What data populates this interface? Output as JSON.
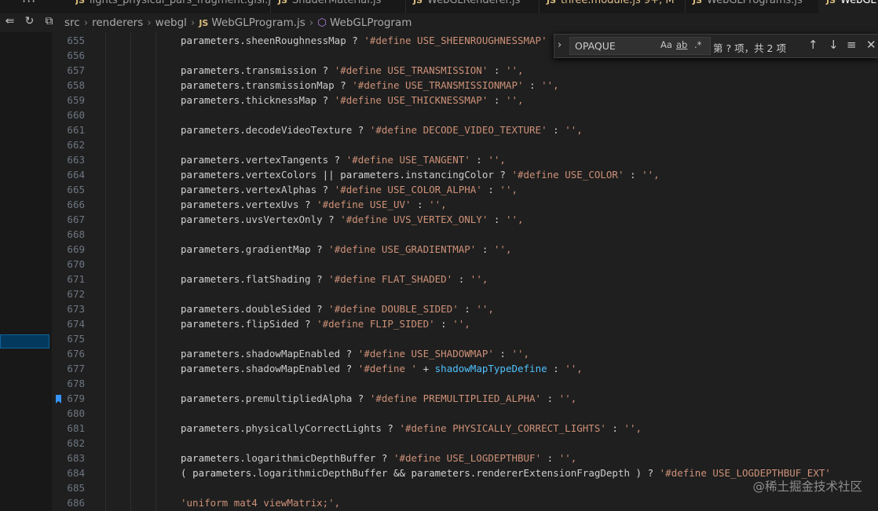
{
  "tabs": [
    {
      "label": "lights_physical_pars_fragment.glsl.js",
      "active": false
    },
    {
      "label": "ShaderMaterial.js",
      "active": false
    },
    {
      "label": "WebGLRenderer.js",
      "active": false
    },
    {
      "label": "three.module.js",
      "badge": "9+, M",
      "active": false,
      "modified": true
    },
    {
      "label": "WebGLPrograms.js",
      "active": false
    },
    {
      "label": "WebGL",
      "active": true
    }
  ],
  "breadcrumb": {
    "items": [
      "src",
      "renderers",
      "webgl",
      "WebGLProgram.js",
      "WebGLProgram"
    ]
  },
  "find": {
    "query": "OPAQUE",
    "options": [
      "Aa",
      "ab",
      ".*"
    ],
    "result": "第 ? 项，共 2 项"
  },
  "icons": {
    "toolbar": [
      "split-editor-icon",
      "undo-icon",
      "copy-icon"
    ],
    "find_toggle": "chevron-right-icon",
    "find_buttons": [
      "arrow-up-icon",
      "arrow-down-icon",
      "selection-icon",
      "close-icon"
    ]
  },
  "colors": {
    "string": "#ce9178",
    "identifier": "#cccccc",
    "highlight_identifier": "#4fc1ff",
    "line_number": "#6e7681",
    "bookmark": "#3794ff"
  },
  "code_lines": [
    {
      "num": "655",
      "segments": [
        [
          "p",
          "parameters."
        ],
        [
          "i",
          "sheenRoughnessMap"
        ],
        [
          "o",
          " ? "
        ],
        [
          "s",
          "'#define USE_SHEENROUGHNESSMAP' : '',"
        ]
      ]
    },
    {
      "num": "656",
      "segments": []
    },
    {
      "num": "657",
      "segments": [
        [
          "p",
          "parameters."
        ],
        [
          "i",
          "transmission"
        ],
        [
          "o",
          " ? "
        ],
        [
          "s",
          "'#define USE_TRANSMISSION'"
        ],
        [
          "o",
          " : "
        ],
        [
          "s",
          "'',"
        ]
      ]
    },
    {
      "num": "658",
      "segments": [
        [
          "p",
          "parameters."
        ],
        [
          "i",
          "transmissionMap"
        ],
        [
          "o",
          " ? "
        ],
        [
          "s",
          "'#define USE_TRANSMISSIONMAP'"
        ],
        [
          "o",
          " : "
        ],
        [
          "s",
          "'',"
        ]
      ]
    },
    {
      "num": "659",
      "segments": [
        [
          "p",
          "parameters."
        ],
        [
          "i",
          "thicknessMap"
        ],
        [
          "o",
          " ? "
        ],
        [
          "s",
          "'#define USE_THICKNESSMAP'"
        ],
        [
          "o",
          " : "
        ],
        [
          "s",
          "'',"
        ]
      ]
    },
    {
      "num": "660",
      "segments": []
    },
    {
      "num": "661",
      "segments": [
        [
          "p",
          "parameters."
        ],
        [
          "i",
          "decodeVideoTexture"
        ],
        [
          "o",
          " ? "
        ],
        [
          "s",
          "'#define DECODE_VIDEO_TEXTURE'"
        ],
        [
          "o",
          " : "
        ],
        [
          "s",
          "'',"
        ]
      ]
    },
    {
      "num": "662",
      "segments": []
    },
    {
      "num": "663",
      "segments": [
        [
          "p",
          "parameters."
        ],
        [
          "i",
          "vertexTangents"
        ],
        [
          "o",
          " ? "
        ],
        [
          "s",
          "'#define USE_TANGENT'"
        ],
        [
          "o",
          " : "
        ],
        [
          "s",
          "'',"
        ]
      ]
    },
    {
      "num": "664",
      "segments": [
        [
          "p",
          "parameters."
        ],
        [
          "i",
          "vertexColors"
        ],
        [
          "o",
          " || "
        ],
        [
          "p",
          "parameters."
        ],
        [
          "i",
          "instancingColor"
        ],
        [
          "o",
          " ? "
        ],
        [
          "s",
          "'#define USE_COLOR'"
        ],
        [
          "o",
          " : "
        ],
        [
          "s",
          "'',"
        ]
      ]
    },
    {
      "num": "665",
      "segments": [
        [
          "p",
          "parameters."
        ],
        [
          "i",
          "vertexAlphas"
        ],
        [
          "o",
          " ? "
        ],
        [
          "s",
          "'#define USE_COLOR_ALPHA'"
        ],
        [
          "o",
          " : "
        ],
        [
          "s",
          "'',"
        ]
      ]
    },
    {
      "num": "666",
      "segments": [
        [
          "p",
          "parameters."
        ],
        [
          "i",
          "vertexUvs"
        ],
        [
          "o",
          " ? "
        ],
        [
          "s",
          "'#define USE_UV'"
        ],
        [
          "o",
          " : "
        ],
        [
          "s",
          "'',"
        ]
      ]
    },
    {
      "num": "667",
      "segments": [
        [
          "p",
          "parameters."
        ],
        [
          "i",
          "uvsVertexOnly"
        ],
        [
          "o",
          " ? "
        ],
        [
          "s",
          "'#define UVS_VERTEX_ONLY'"
        ],
        [
          "o",
          " : "
        ],
        [
          "s",
          "'',"
        ]
      ]
    },
    {
      "num": "668",
      "segments": []
    },
    {
      "num": "669",
      "segments": [
        [
          "p",
          "parameters."
        ],
        [
          "i",
          "gradientMap"
        ],
        [
          "o",
          " ? "
        ],
        [
          "s",
          "'#define USE_GRADIENTMAP'"
        ],
        [
          "o",
          " : "
        ],
        [
          "s",
          "'',"
        ]
      ]
    },
    {
      "num": "670",
      "segments": []
    },
    {
      "num": "671",
      "segments": [
        [
          "p",
          "parameters."
        ],
        [
          "i",
          "flatShading"
        ],
        [
          "o",
          " ? "
        ],
        [
          "s",
          "'#define FLAT_SHADED'"
        ],
        [
          "o",
          " : "
        ],
        [
          "s",
          "'',"
        ]
      ]
    },
    {
      "num": "672",
      "segments": []
    },
    {
      "num": "673",
      "segments": [
        [
          "p",
          "parameters."
        ],
        [
          "i",
          "doubleSided"
        ],
        [
          "o",
          " ? "
        ],
        [
          "s",
          "'#define DOUBLE_SIDED'"
        ],
        [
          "o",
          " : "
        ],
        [
          "s",
          "'',"
        ]
      ]
    },
    {
      "num": "674",
      "segments": [
        [
          "p",
          "parameters."
        ],
        [
          "i",
          "flipSided"
        ],
        [
          "o",
          " ? "
        ],
        [
          "s",
          "'#define FLIP_SIDED'"
        ],
        [
          "o",
          " : "
        ],
        [
          "s",
          "'',"
        ]
      ]
    },
    {
      "num": "675",
      "segments": []
    },
    {
      "num": "676",
      "segments": [
        [
          "p",
          "parameters."
        ],
        [
          "i",
          "shadowMapEnabled"
        ],
        [
          "o",
          " ? "
        ],
        [
          "s",
          "'#define USE_SHADOWMAP'"
        ],
        [
          "o",
          " : "
        ],
        [
          "s",
          "'',"
        ]
      ]
    },
    {
      "num": "677",
      "segments": [
        [
          "p",
          "parameters."
        ],
        [
          "i",
          "shadowMapEnabled"
        ],
        [
          "o",
          " ? "
        ],
        [
          "s",
          "'#define '"
        ],
        [
          "o",
          " + "
        ],
        [
          "h",
          "shadowMapTypeDefine"
        ],
        [
          "o",
          " : "
        ],
        [
          "s",
          "'',"
        ]
      ]
    },
    {
      "num": "678",
      "segments": []
    },
    {
      "num": "679",
      "segments": [
        [
          "p",
          "parameters."
        ],
        [
          "i",
          "premultipliedAlpha"
        ],
        [
          "o",
          " ? "
        ],
        [
          "s",
          "'#define PREMULTIPLIED_ALPHA'"
        ],
        [
          "o",
          " : "
        ],
        [
          "s",
          "'',"
        ]
      ],
      "bookmark": true
    },
    {
      "num": "680",
      "segments": []
    },
    {
      "num": "681",
      "segments": [
        [
          "p",
          "parameters."
        ],
        [
          "i",
          "physicallyCorrectLights"
        ],
        [
          "o",
          " ? "
        ],
        [
          "s",
          "'#define PHYSICALLY_CORRECT_LIGHTS'"
        ],
        [
          "o",
          " : "
        ],
        [
          "s",
          "'',"
        ]
      ]
    },
    {
      "num": "682",
      "segments": []
    },
    {
      "num": "683",
      "segments": [
        [
          "p",
          "parameters."
        ],
        [
          "i",
          "logarithmicDepthBuffer"
        ],
        [
          "o",
          " ? "
        ],
        [
          "s",
          "'#define USE_LOGDEPTHBUF'"
        ],
        [
          "o",
          " : "
        ],
        [
          "s",
          "'',"
        ]
      ]
    },
    {
      "num": "684",
      "segments": [
        [
          "o",
          "( "
        ],
        [
          "p",
          "parameters."
        ],
        [
          "i",
          "logarithmicDepthBuffer"
        ],
        [
          "o",
          " && "
        ],
        [
          "p",
          "parameters."
        ],
        [
          "i",
          "rendererExtensionFragDepth"
        ],
        [
          "o",
          " ) ? "
        ],
        [
          "s",
          "'#define USE_LOGDEPTHBUF_EXT'"
        ]
      ]
    },
    {
      "num": "685",
      "segments": []
    },
    {
      "num": "686",
      "segments": [
        [
          "s",
          "'uniform mat4 viewMatrix;',"
        ]
      ]
    }
  ],
  "watermark": "@稀土掘金技术社区"
}
